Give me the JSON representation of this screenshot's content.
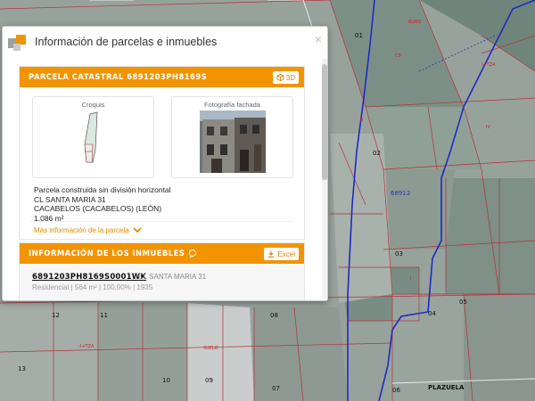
{
  "dialog": {
    "title": "Información de parcelas e inmuebles",
    "close_glyph": "×"
  },
  "parcel": {
    "header": "PARCELA CATASTRAL 6891203PH8169S",
    "btn_3d": "3D",
    "croquis_caption": "Croquis",
    "facade_caption": "Fotografía fachada",
    "line1": "Parcela construida sin división horizontal",
    "line2": "CL SANTA MARIA 31",
    "line3": "CACABELOS (CACABELOS) (LEÓN)",
    "area": "1.086 m²",
    "more_info": "Más información de la parcela"
  },
  "inmuebles": {
    "header": "INFORMACIÓN DE LOS INMUEBLES",
    "excel_label": "Excel",
    "items": [
      {
        "ref": "6891203PH8169S0001WK",
        "address": "CL SANTA MARIA 31",
        "details": "Residencial | 564 m² | 100,00% | 1935"
      }
    ]
  },
  "map": {
    "labels": [
      "01",
      "02",
      "03",
      "04",
      "05",
      "06",
      "07",
      "08",
      "09",
      "10",
      "11",
      "12",
      "13",
      "68912",
      "PLAZUELA",
      "C0",
      "I+TZA",
      "-I+TZA",
      "II",
      "I",
      "IV",
      "BUBO",
      "SUELO"
    ]
  },
  "colors": {
    "accent": "#f29400",
    "map_background": "#8e9a94",
    "parcel_lines": "#b3323a",
    "boundary_blue": "#1f2ac4"
  },
  "icons": {
    "close": "close-icon",
    "cube_3d": "cube-3d-icon",
    "download": "download-icon",
    "chevron": "chevron-down-icon",
    "app_logo": "catastro-logo-icon"
  }
}
